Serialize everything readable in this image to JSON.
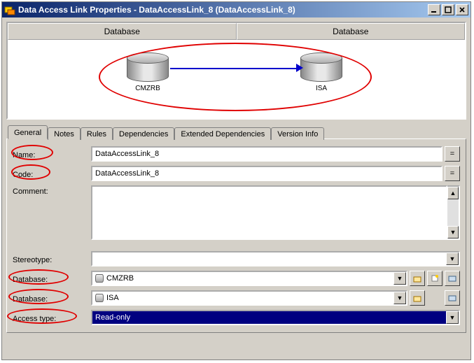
{
  "titlebar": {
    "title": "Data Access Link Properties - DataAccessLink_8 (DataAccessLink_8)"
  },
  "diagram": {
    "header_left": "Database",
    "header_right": "Database",
    "node_left": "CMZRB",
    "node_right": "ISA"
  },
  "tabs": [
    "General",
    "Notes",
    "Rules",
    "Dependencies",
    "Extended Dependencies",
    "Version Info"
  ],
  "form": {
    "name_label": "Name:",
    "name_value": "DataAccessLink_8",
    "code_label": "Code:",
    "code_value": "DataAccessLink_8",
    "comment_label": "Comment:",
    "comment_value": "",
    "stereotype_label": "Stereotype:",
    "stereotype_value": "",
    "database1_label": "Database:",
    "database1_value": "CMZRB",
    "database2_label": "Database:",
    "database2_value": "ISA",
    "access_type_label": "Access type:",
    "access_type_value": "Read-only",
    "eq_button": "="
  }
}
